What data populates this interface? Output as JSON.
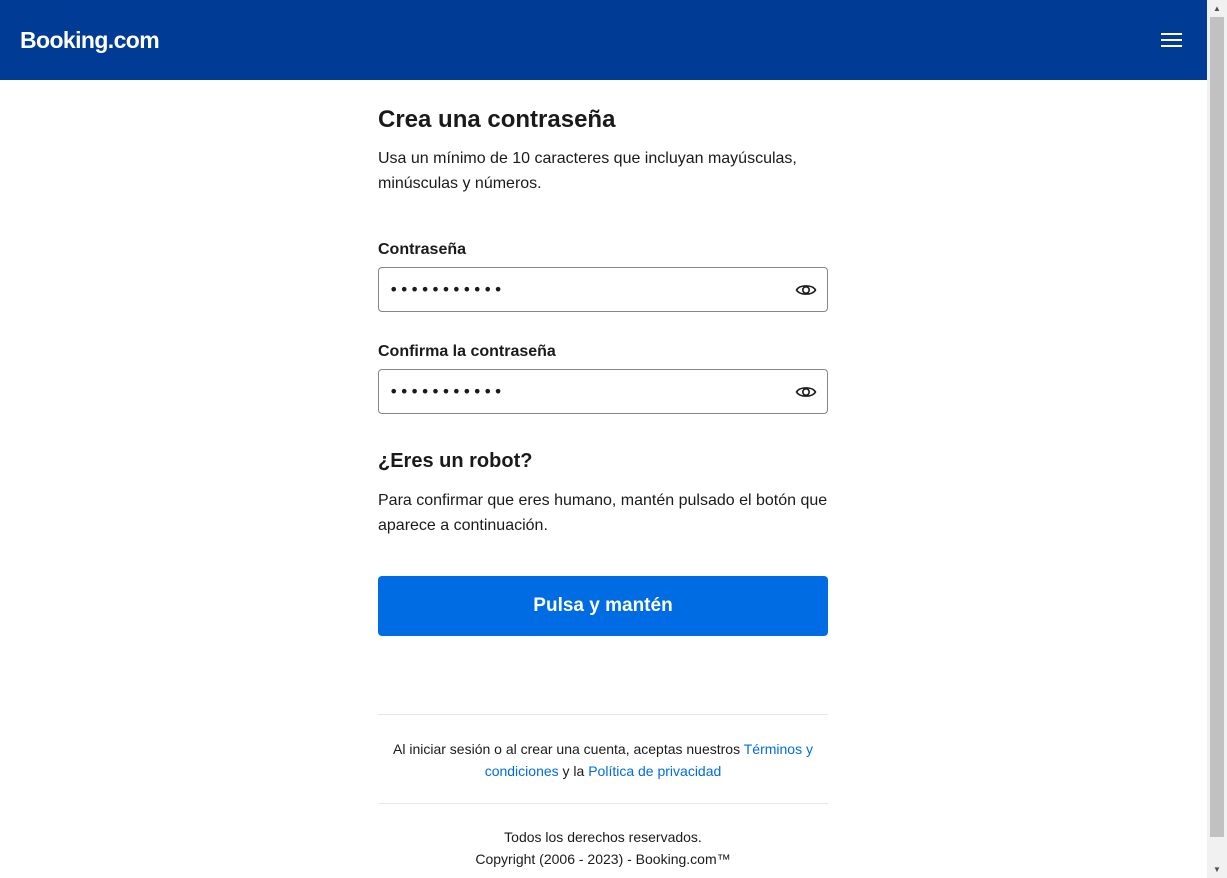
{
  "header": {
    "logo": "Booking.com",
    "menu_icon": "hamburger-menu-icon"
  },
  "colors": {
    "brand_header": "#003b95",
    "primary_button": "#006ce4",
    "link": "#006ce4"
  },
  "form": {
    "title": "Crea una contraseña",
    "subtitle": "Usa un mínimo de 10 caracteres que incluyan mayúsculas, minúsculas y números.",
    "password": {
      "label": "Contraseña",
      "value": "•••••••••••",
      "toggle_icon": "eye-icon"
    },
    "confirm_password": {
      "label": "Confirma la contraseña",
      "value": "•••••••••••",
      "toggle_icon": "eye-icon"
    }
  },
  "robot_check": {
    "title": "¿Eres un robot?",
    "text": "Para confirmar que eres humano, mantén pulsado el botón que aparece a continuación.",
    "button_label": "Pulsa y mantén"
  },
  "legal": {
    "prefix": "Al iniciar sesión o al crear una cuenta, aceptas nuestros",
    "terms_link": "Términos y condiciones",
    "conjunction": "y la",
    "privacy_link": "Política de privacidad"
  },
  "footer": {
    "rights": "Todos los derechos reservados.",
    "copyright": "Copyright (2006 - 2023) - Booking.com™"
  }
}
